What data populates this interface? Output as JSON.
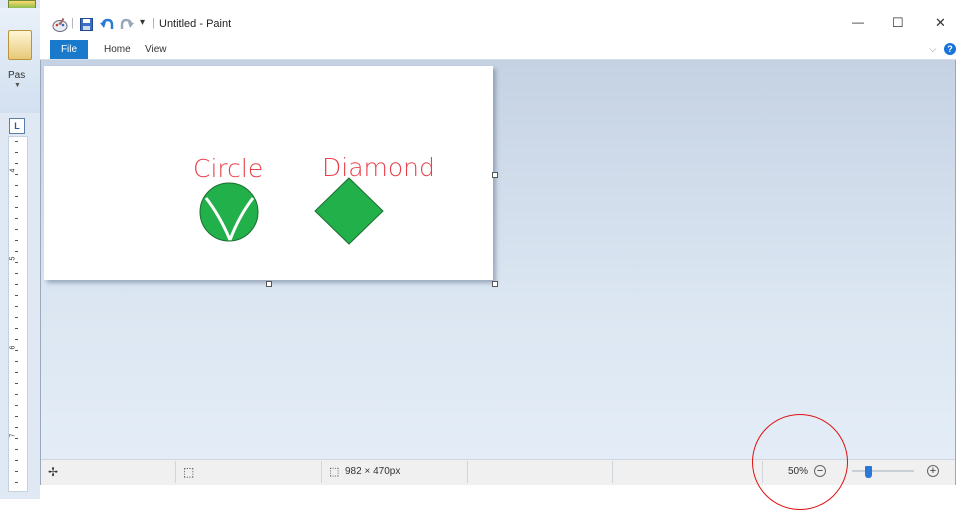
{
  "background_window": {
    "paste_label": "Pas",
    "ruler_button": "L",
    "ruler_numbers": [
      "4",
      "5",
      "6",
      "7"
    ]
  },
  "titlebar": {
    "title": "Untitled - Paint",
    "separator": "|",
    "qat_dropdown": "▾",
    "minimize": "—",
    "maximize": "☐",
    "close": "✕"
  },
  "menubar": {
    "file_label": "File",
    "items": [
      "Home",
      "View"
    ],
    "collapse": "⌵",
    "help": "?"
  },
  "drawing": {
    "label_circle": "Circle",
    "label_diamond": "Diamond",
    "label_color": "#e8404a",
    "shape_fill": "#22b04a",
    "shape_stroke": "#1a6e30"
  },
  "statusbar": {
    "move_icon": "✢",
    "selection_icon": "⬚",
    "canvas_size_icon": "⬚",
    "canvas_size": "982 × 470px",
    "zoom_level": "50%",
    "zoom_out": "−",
    "zoom_in": "+",
    "zoom_fraction": 0.25
  },
  "annotation": {
    "color": "#e01010"
  }
}
